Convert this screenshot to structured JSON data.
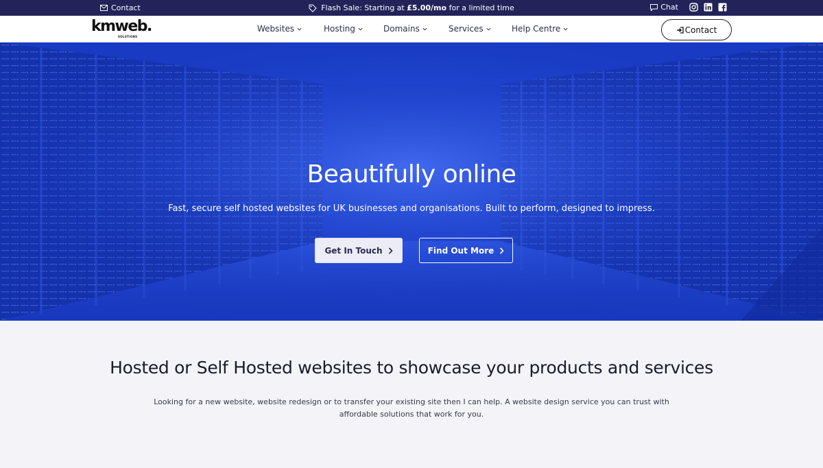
{
  "topbar": {
    "contact_label": "Contact",
    "flash_prefix": "Flash Sale: Starting at ",
    "flash_price": "£5.00/mo",
    "flash_suffix": " for a limited time",
    "chat_label": "Chat",
    "social_icons": [
      "instagram-icon",
      "linkedin-icon",
      "facebook-icon"
    ]
  },
  "nav": {
    "logo": "kmweb.",
    "logo_sub": "SOLUTIONS",
    "items": [
      {
        "label": "Websites"
      },
      {
        "label": "Hosting"
      },
      {
        "label": "Domains"
      },
      {
        "label": "Services"
      },
      {
        "label": "Help Centre"
      }
    ],
    "contact_button": "Contact"
  },
  "hero": {
    "title": "Beautifully online",
    "subtitle": "Fast, secure self hosted websites for UK businesses and organisations. Built to perform, designed to impress.",
    "primary_button": "Get In Touch",
    "secondary_button": "Find Out More"
  },
  "intro": {
    "heading": "Hosted or Self Hosted websites to showcase your products and services",
    "body": "Looking for a new website, website redesign or to transfer your existing site then I can help. A website design service you can trust with affordable solutions that work for you."
  },
  "colors": {
    "topbar": "#23235a",
    "hero": "#1a3bc2",
    "page_bg": "#f3f3f8"
  }
}
